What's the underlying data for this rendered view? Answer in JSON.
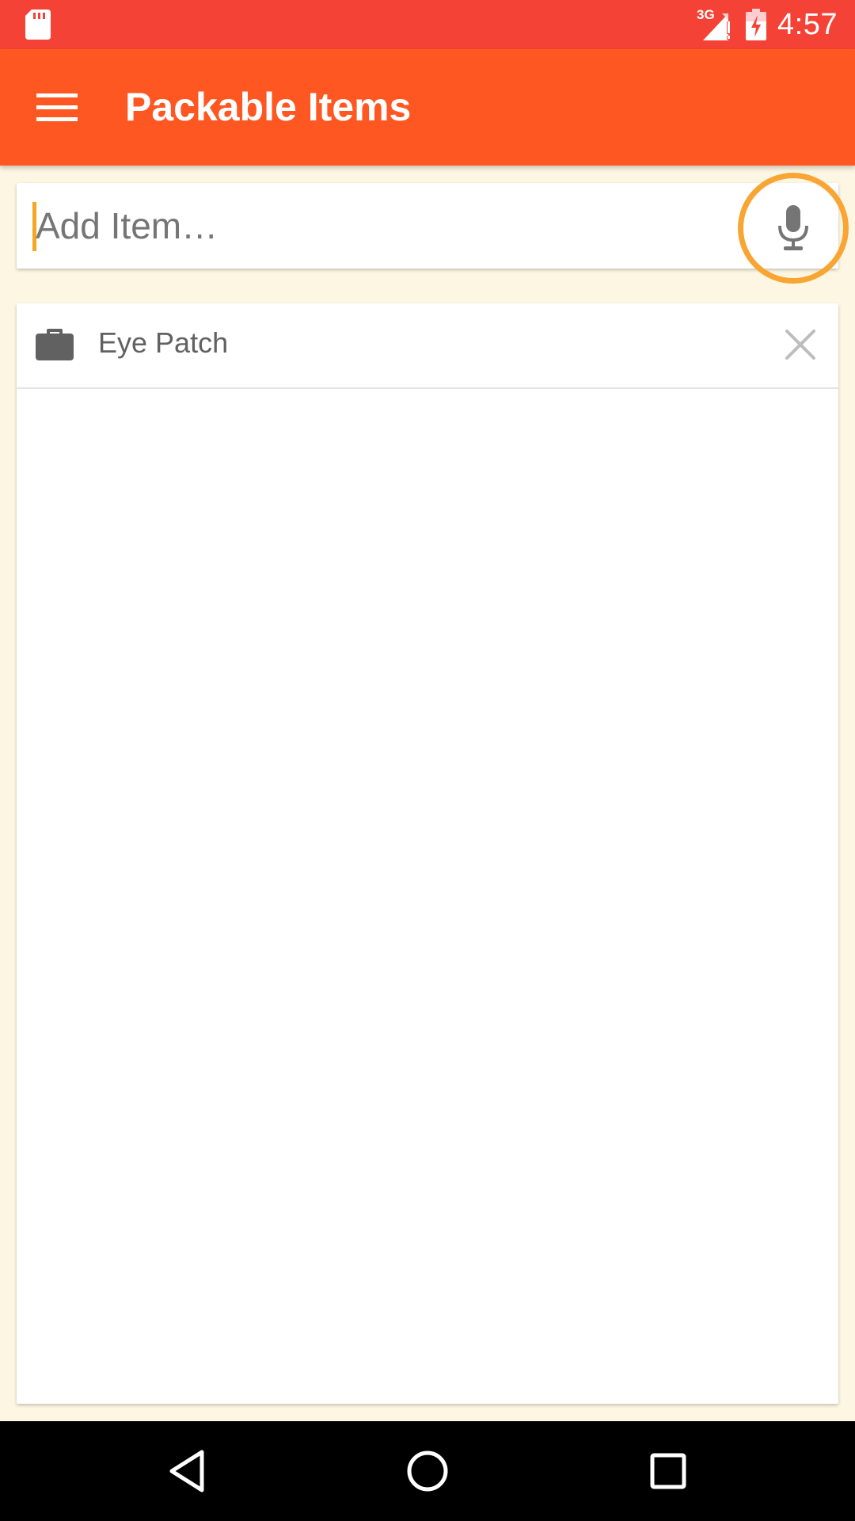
{
  "status_bar": {
    "network_type": "3G",
    "time": "4:57",
    "icons": [
      "sd-card-icon",
      "signal-icon",
      "battery-charging-icon"
    ]
  },
  "app_bar": {
    "title": "Packable Items",
    "menu_icon": "hamburger-menu-icon"
  },
  "add_item": {
    "placeholder": "Add Item…",
    "value": "",
    "mic_icon": "microphone-icon"
  },
  "items": [
    {
      "label": "Eye Patch",
      "icon": "briefcase-icon",
      "remove_icon": "close-icon"
    }
  ],
  "nav_bar": {
    "buttons": [
      "back-icon",
      "home-icon",
      "recents-icon"
    ]
  },
  "colors": {
    "status_bar": "#f44336",
    "app_bar": "#ff5722",
    "background": "#fdf6e3",
    "highlight_ring": "#f9a534",
    "caret": "#f5a623"
  }
}
